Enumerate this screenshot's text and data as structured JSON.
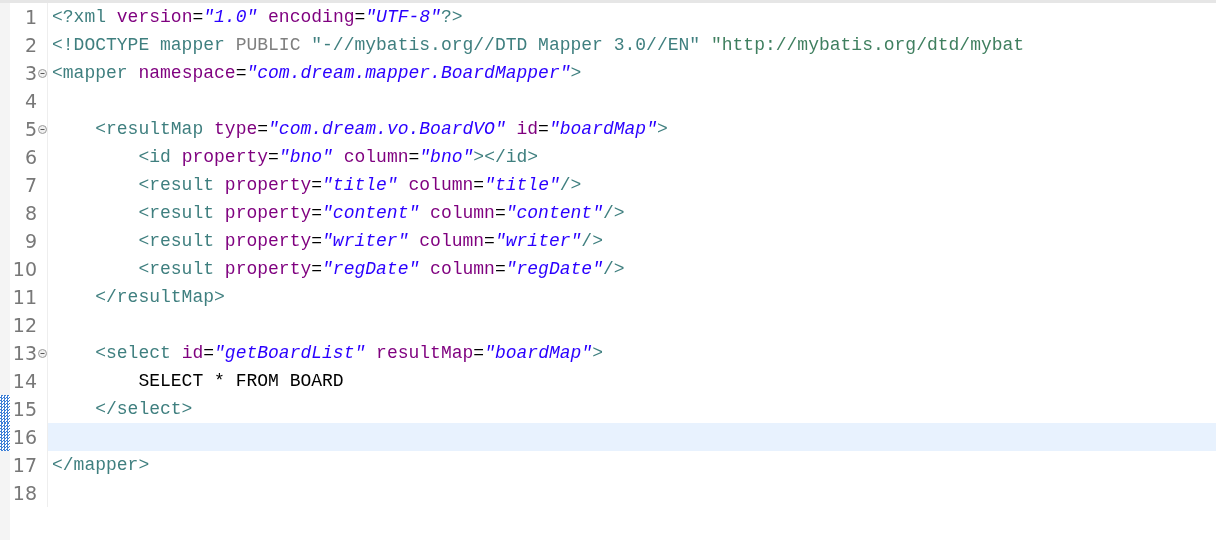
{
  "editor": {
    "lines": [
      {
        "number": "1",
        "foldable": false,
        "current": false,
        "changed": false,
        "tokens": [
          {
            "kind": "tag",
            "text": "<?xml"
          },
          {
            "kind": "attr",
            "text": " version"
          },
          {
            "kind": "punct",
            "text": "="
          },
          {
            "kind": "value",
            "text": "\"1.0\""
          },
          {
            "kind": "attr",
            "text": " encoding"
          },
          {
            "kind": "punct",
            "text": "="
          },
          {
            "kind": "value",
            "text": "\"UTF-8\""
          },
          {
            "kind": "tag",
            "text": "?>"
          }
        ]
      },
      {
        "number": "2",
        "foldable": false,
        "current": false,
        "changed": false,
        "tokens": [
          {
            "kind": "tag",
            "text": "<!DOCTYPE mapper "
          },
          {
            "kind": "keyword",
            "text": "PUBLIC"
          },
          {
            "kind": "tag",
            "text": " \"-//mybatis.org//DTD Mapper 3.0//EN\" "
          },
          {
            "kind": "doctype",
            "text": "\"http://mybatis.org/dtd/mybat"
          }
        ]
      },
      {
        "number": "3",
        "foldable": true,
        "current": false,
        "changed": false,
        "tokens": [
          {
            "kind": "tag",
            "text": "<mapper"
          },
          {
            "kind": "attr",
            "text": " namespace"
          },
          {
            "kind": "punct",
            "text": "="
          },
          {
            "kind": "value",
            "text": "\"com.dream.mapper.BoardMapper\""
          },
          {
            "kind": "tag",
            "text": ">"
          }
        ]
      },
      {
        "number": "4",
        "foldable": false,
        "current": false,
        "changed": false
      },
      {
        "number": "5",
        "foldable": true,
        "current": false,
        "changed": false,
        "tokens": [
          {
            "kind": "tag",
            "text": "    <resultMap"
          },
          {
            "kind": "attr",
            "text": " type"
          },
          {
            "kind": "punct",
            "text": "="
          },
          {
            "kind": "value",
            "text": "\"com.dream.vo.BoardVO\""
          },
          {
            "kind": "attr",
            "text": " id"
          },
          {
            "kind": "punct",
            "text": "="
          },
          {
            "kind": "value",
            "text": "\"boardMap\""
          },
          {
            "kind": "tag",
            "text": ">"
          }
        ]
      },
      {
        "number": "6",
        "foldable": false,
        "current": false,
        "changed": false,
        "tokens": [
          {
            "kind": "tag",
            "text": "        <id"
          },
          {
            "kind": "attr",
            "text": " property"
          },
          {
            "kind": "punct",
            "text": "="
          },
          {
            "kind": "value",
            "text": "\"bno\""
          },
          {
            "kind": "attr",
            "text": " column"
          },
          {
            "kind": "punct",
            "text": "="
          },
          {
            "kind": "value",
            "text": "\"bno\""
          },
          {
            "kind": "tag",
            "text": "></id>"
          }
        ]
      },
      {
        "number": "7",
        "foldable": false,
        "current": false,
        "changed": false,
        "tokens": [
          {
            "kind": "tag",
            "text": "        <result"
          },
          {
            "kind": "attr",
            "text": " property"
          },
          {
            "kind": "punct",
            "text": "="
          },
          {
            "kind": "value",
            "text": "\"title\""
          },
          {
            "kind": "attr",
            "text": " column"
          },
          {
            "kind": "punct",
            "text": "="
          },
          {
            "kind": "value",
            "text": "\"title\""
          },
          {
            "kind": "tag",
            "text": "/>"
          }
        ]
      },
      {
        "number": "8",
        "foldable": false,
        "current": false,
        "changed": false,
        "tokens": [
          {
            "kind": "tag",
            "text": "        <result"
          },
          {
            "kind": "attr",
            "text": " property"
          },
          {
            "kind": "punct",
            "text": "="
          },
          {
            "kind": "value",
            "text": "\"content\""
          },
          {
            "kind": "attr",
            "text": " column"
          },
          {
            "kind": "punct",
            "text": "="
          },
          {
            "kind": "value",
            "text": "\"content\""
          },
          {
            "kind": "tag",
            "text": "/>"
          }
        ]
      },
      {
        "number": "9",
        "foldable": false,
        "current": false,
        "changed": false,
        "tokens": [
          {
            "kind": "tag",
            "text": "        <result"
          },
          {
            "kind": "attr",
            "text": " property"
          },
          {
            "kind": "punct",
            "text": "="
          },
          {
            "kind": "value",
            "text": "\"writer\""
          },
          {
            "kind": "attr",
            "text": " column"
          },
          {
            "kind": "punct",
            "text": "="
          },
          {
            "kind": "value",
            "text": "\"writer\""
          },
          {
            "kind": "tag",
            "text": "/>"
          }
        ]
      },
      {
        "number": "10",
        "foldable": false,
        "current": false,
        "changed": false,
        "tokens": [
          {
            "kind": "tag",
            "text": "        <result"
          },
          {
            "kind": "attr",
            "text": " property"
          },
          {
            "kind": "punct",
            "text": "="
          },
          {
            "kind": "value",
            "text": "\"regDate\""
          },
          {
            "kind": "attr",
            "text": " column"
          },
          {
            "kind": "punct",
            "text": "="
          },
          {
            "kind": "value",
            "text": "\"regDate\""
          },
          {
            "kind": "tag",
            "text": "/>"
          }
        ]
      },
      {
        "number": "11",
        "foldable": false,
        "current": false,
        "changed": false,
        "tokens": [
          {
            "kind": "tag",
            "text": "    </resultMap>"
          }
        ]
      },
      {
        "number": "12",
        "foldable": false,
        "current": false,
        "changed": false
      },
      {
        "number": "13",
        "foldable": true,
        "current": false,
        "changed": false,
        "tokens": [
          {
            "kind": "tag",
            "text": "    <select"
          },
          {
            "kind": "attr",
            "text": " id"
          },
          {
            "kind": "punct",
            "text": "="
          },
          {
            "kind": "value",
            "text": "\"getBoardList\""
          },
          {
            "kind": "attr",
            "text": " resultMap"
          },
          {
            "kind": "punct",
            "text": "="
          },
          {
            "kind": "value",
            "text": "\"boardMap\""
          },
          {
            "kind": "tag",
            "text": ">"
          }
        ]
      },
      {
        "number": "14",
        "foldable": false,
        "current": false,
        "changed": false,
        "tokens": [
          {
            "kind": "text",
            "text": "        SELECT * FROM BOARD"
          }
        ]
      },
      {
        "number": "15",
        "foldable": false,
        "current": false,
        "changed": true,
        "tokens": [
          {
            "kind": "tag",
            "text": "    </select>"
          }
        ]
      },
      {
        "number": "16",
        "foldable": false,
        "current": true,
        "changed": true
      },
      {
        "number": "17",
        "foldable": false,
        "current": false,
        "changed": false,
        "tokens": [
          {
            "kind": "tag",
            "text": "</mapper>"
          }
        ]
      },
      {
        "number": "18",
        "foldable": false,
        "current": false,
        "changed": false
      }
    ]
  }
}
